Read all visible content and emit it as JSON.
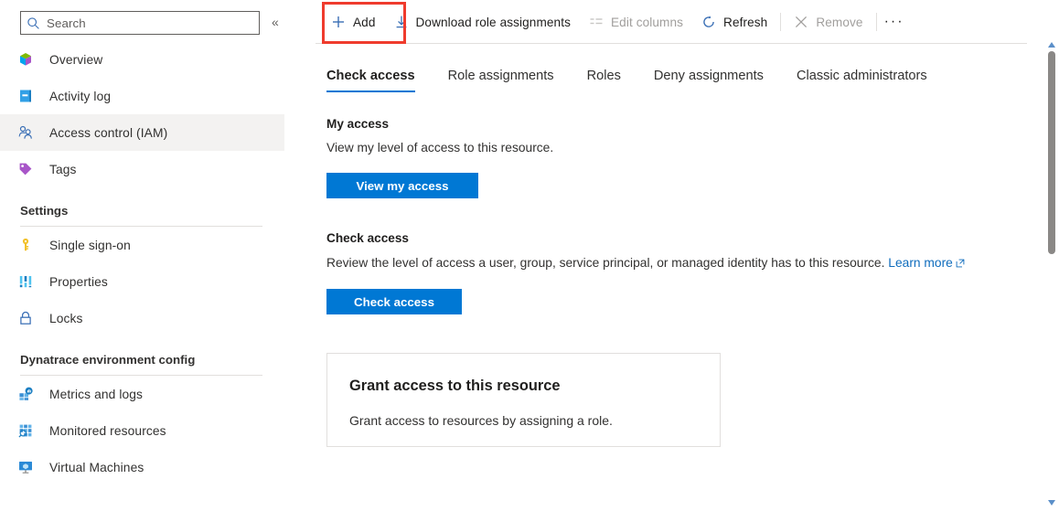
{
  "sidebar": {
    "search": {
      "placeholder": "Search",
      "value": "",
      "icon": "search-icon"
    },
    "collapse_icon": "chevron-double-left-icon",
    "items": [
      {
        "label": "Overview",
        "icon": "overview-cube-icon",
        "selected": false
      },
      {
        "label": "Activity log",
        "icon": "activity-log-icon",
        "selected": false
      },
      {
        "label": "Access control (IAM)",
        "icon": "access-control-people-icon",
        "selected": true
      },
      {
        "label": "Tags",
        "icon": "tag-icon",
        "selected": false
      }
    ],
    "groups": [
      {
        "title": "Settings",
        "items": [
          {
            "label": "Single sign-on",
            "icon": "key-icon"
          },
          {
            "label": "Properties",
            "icon": "properties-bars-icon"
          },
          {
            "label": "Locks",
            "icon": "lock-icon"
          }
        ]
      },
      {
        "title": "Dynatrace environment config",
        "items": [
          {
            "label": "Metrics and logs",
            "icon": "metrics-and-logs-icon"
          },
          {
            "label": "Monitored resources",
            "icon": "monitored-resources-icon"
          },
          {
            "label": "Virtual Machines",
            "icon": "virtual-machine-icon"
          }
        ]
      }
    ]
  },
  "toolbar": {
    "add_label": "Add",
    "download_label": "Download role assignments",
    "edit_columns_label": "Edit columns",
    "refresh_label": "Refresh",
    "remove_label": "Remove",
    "more_label": "···",
    "highlight_color": "#ef3b2d",
    "highlighted_command": "Add"
  },
  "tabs": [
    {
      "label": "Check access",
      "active": true
    },
    {
      "label": "Role assignments",
      "active": false
    },
    {
      "label": "Roles",
      "active": false
    },
    {
      "label": "Deny assignments",
      "active": false
    },
    {
      "label": "Classic administrators",
      "active": false
    }
  ],
  "main": {
    "my_access": {
      "title": "My access",
      "description": "View my level of access to this resource.",
      "button": "View my access"
    },
    "check_access": {
      "title": "Check access",
      "description": "Review the level of access a user, group, service principal, or managed identity has to this resource.",
      "link_text": "Learn more",
      "button": "Check access"
    },
    "grant_card": {
      "title": "Grant access to this resource",
      "description": "Grant access to resources by assigning a role."
    }
  },
  "colors": {
    "accent": "#0078d4",
    "link": "#0f6cbd",
    "selected_bg": "#f3f2f1",
    "divider": "#e1dfdd",
    "highlight": "#ef3b2d"
  }
}
